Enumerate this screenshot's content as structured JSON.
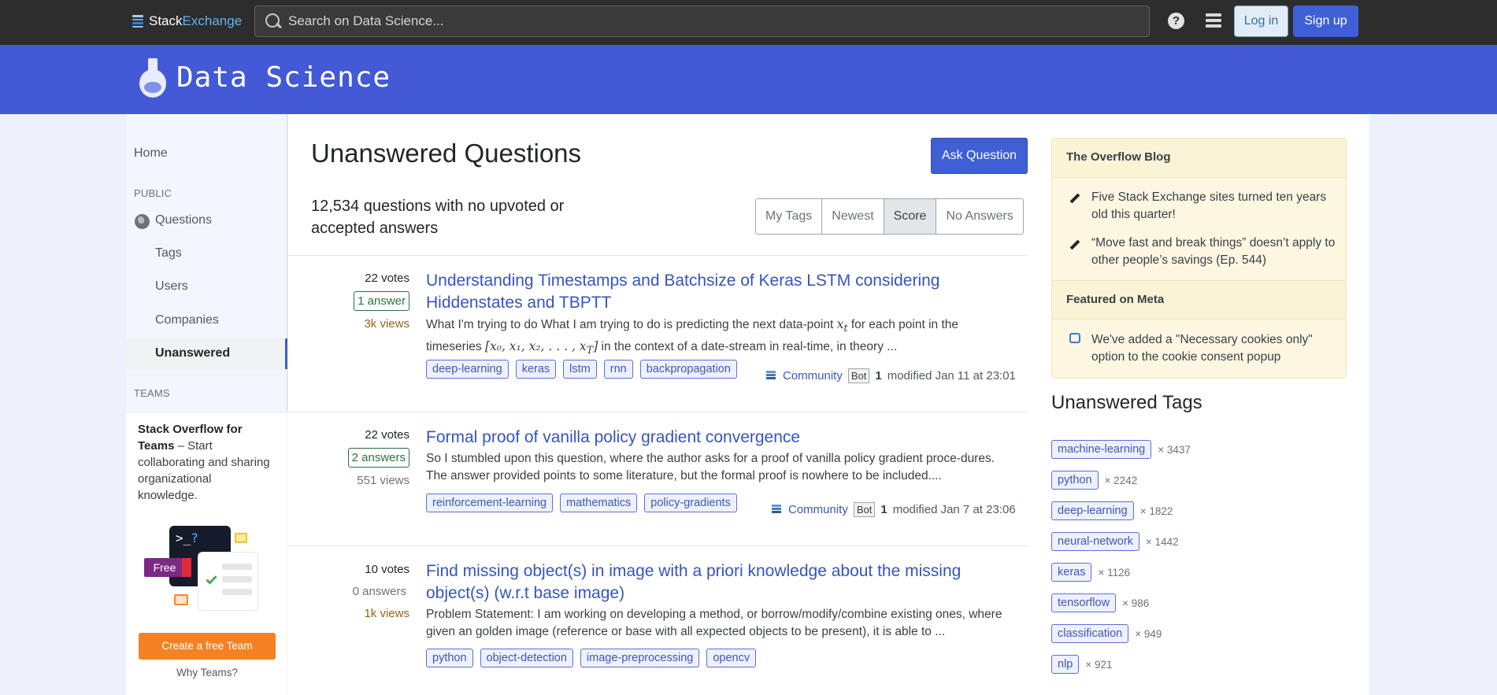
{
  "topbar": {
    "logo_part1": "Stack",
    "logo_part2": "Exchange",
    "search_placeholder": "Search on Data Science...",
    "help_label": "?",
    "login_label": "Log in",
    "signup_label": "Sign up"
  },
  "site": {
    "title": "Data Science"
  },
  "leftnav": {
    "home": "Home",
    "public_section": "PUBLIC",
    "questions": "Questions",
    "tags": "Tags",
    "users": "Users",
    "companies": "Companies",
    "unanswered": "Unanswered",
    "teams_section": "TEAMS",
    "teams_bold": "Stack Overflow for Teams",
    "teams_text": " – Start collaborating and sharing organizational knowledge.",
    "terminal_prompt": ">_",
    "terminal_q": "?",
    "free_badge": "Free",
    "create_team": "Create a free Team",
    "why_teams": "Why Teams?"
  },
  "main": {
    "title": "Unanswered Questions",
    "ask_button": "Ask Question",
    "count_text": "12,534 questions with no upvoted or accepted answers",
    "filters": [
      "My Tags",
      "Newest",
      "Score",
      "No Answers"
    ],
    "selected_filter": "Score",
    "questions": [
      {
        "votes": "22 votes",
        "answers": "1 answer",
        "views": "3k views",
        "title": "Understanding Timestamps and Batchsize of Keras LSTM considering Hiddenstates and TBPTT",
        "excerpt_1a": "What I'm trying to do What I am trying to do is predicting the next data-point ",
        "excerpt_1m": "x",
        "excerpt_1sub": "t",
        "excerpt_1b": " for each point in the",
        "excerpt_2a": "timeseries ",
        "excerpt_2m": "[x₀, x₁, x₂, . . . , x",
        "excerpt_2sub": "T",
        "excerpt_2m2": "]",
        "excerpt_2b": " in the context of a date-stream in real-time, in theory ...",
        "tags": [
          "deep-learning",
          "keras",
          "lstm",
          "rnn",
          "backpropagation"
        ],
        "user": "Community",
        "bot": "Bot",
        "rep": "1",
        "modified": "modified Jan 11 at 23:01"
      },
      {
        "votes": "22 votes",
        "answers": "2 answers",
        "views": "551 views",
        "title": "Formal proof of vanilla policy gradient convergence",
        "excerpt": "So I stumbled upon this question, where the author asks for a proof of vanilla policy gradient proce-dures. The answer provided points to some literature, but the formal proof is nowhere to be included....",
        "tags": [
          "reinforcement-learning",
          "mathematics",
          "policy-gradients"
        ],
        "user": "Community",
        "bot": "Bot",
        "rep": "1",
        "modified": "modified Jan 7 at 23:06"
      },
      {
        "votes": "10 votes",
        "answers": "0 answers",
        "views": "1k views",
        "title": "Find missing object(s) in image with a priori knowledge about the missing object(s) (w.r.t base image)",
        "excerpt": "Problem Statement: I am working on developing a method, or borrow/modify/combine existing ones, where given an golden image (reference or base with all expected objects to be present), it is able to ...",
        "tags": [
          "python",
          "object-detection",
          "image-preprocessing",
          "opencv"
        ]
      }
    ]
  },
  "sidebar": {
    "blog_title": "The Overflow Blog",
    "blog_items": [
      "Five Stack Exchange sites turned ten years old this quarter!",
      "“Move fast and break things” doesn’t apply to other people’s savings (Ep. 544)"
    ],
    "meta_title": "Featured on Meta",
    "meta_items": [
      "We've added a \"Necessary cookies only\" option to the cookie consent popup"
    ],
    "unanswered_tags_title": "Unanswered Tags",
    "unanswered_tags": [
      {
        "name": "machine-learning",
        "count": "× 3437"
      },
      {
        "name": "python",
        "count": "× 2242"
      },
      {
        "name": "deep-learning",
        "count": "× 1822"
      },
      {
        "name": "neural-network",
        "count": "× 1442"
      },
      {
        "name": "keras",
        "count": "× 1126"
      },
      {
        "name": "tensorflow",
        "count": "× 986"
      },
      {
        "name": "classification",
        "count": "× 949"
      },
      {
        "name": "nlp",
        "count": "× 921"
      }
    ]
  },
  "colors": {
    "brand_blue": "#4359d5",
    "button_blue": "#3f5fd4",
    "accent_orange": "#f48225",
    "topbar_bg": "#2d2d2d"
  }
}
